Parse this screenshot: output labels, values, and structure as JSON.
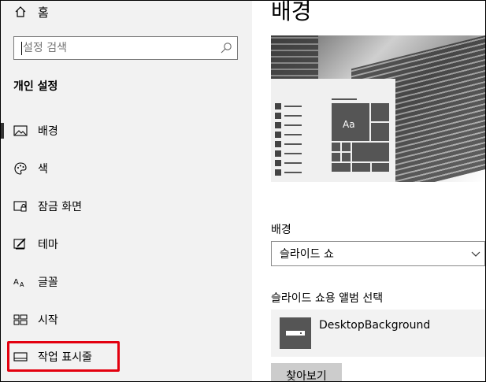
{
  "sidebar": {
    "home_label": "홈",
    "search_placeholder": "설정 검색",
    "section_title": "개인 설정",
    "items": [
      {
        "label": "배경",
        "icon": "picture-icon"
      },
      {
        "label": "색",
        "icon": "palette-icon"
      },
      {
        "label": "잠금 화면",
        "icon": "lock-screen-icon"
      },
      {
        "label": "테마",
        "icon": "theme-icon"
      },
      {
        "label": "글꼴",
        "icon": "font-icon"
      },
      {
        "label": "시작",
        "icon": "start-icon"
      },
      {
        "label": "작업 표시줄",
        "icon": "taskbar-icon"
      }
    ],
    "active_index": 0,
    "highlighted_index": 6
  },
  "main": {
    "title": "배경",
    "preview_tile_text": "Aa",
    "background_label": "배경",
    "background_value": "슬라이드 쇼",
    "album_label": "슬라이드 쇼용 앨범 선택",
    "album_folder": "DesktopBackground",
    "browse_label": "찾아보기"
  },
  "colors": {
    "sidebar_bg": "#f2f2f2",
    "highlight_border": "#e3000f",
    "tile_gray": "#555555",
    "button_bg": "#cccccc"
  }
}
